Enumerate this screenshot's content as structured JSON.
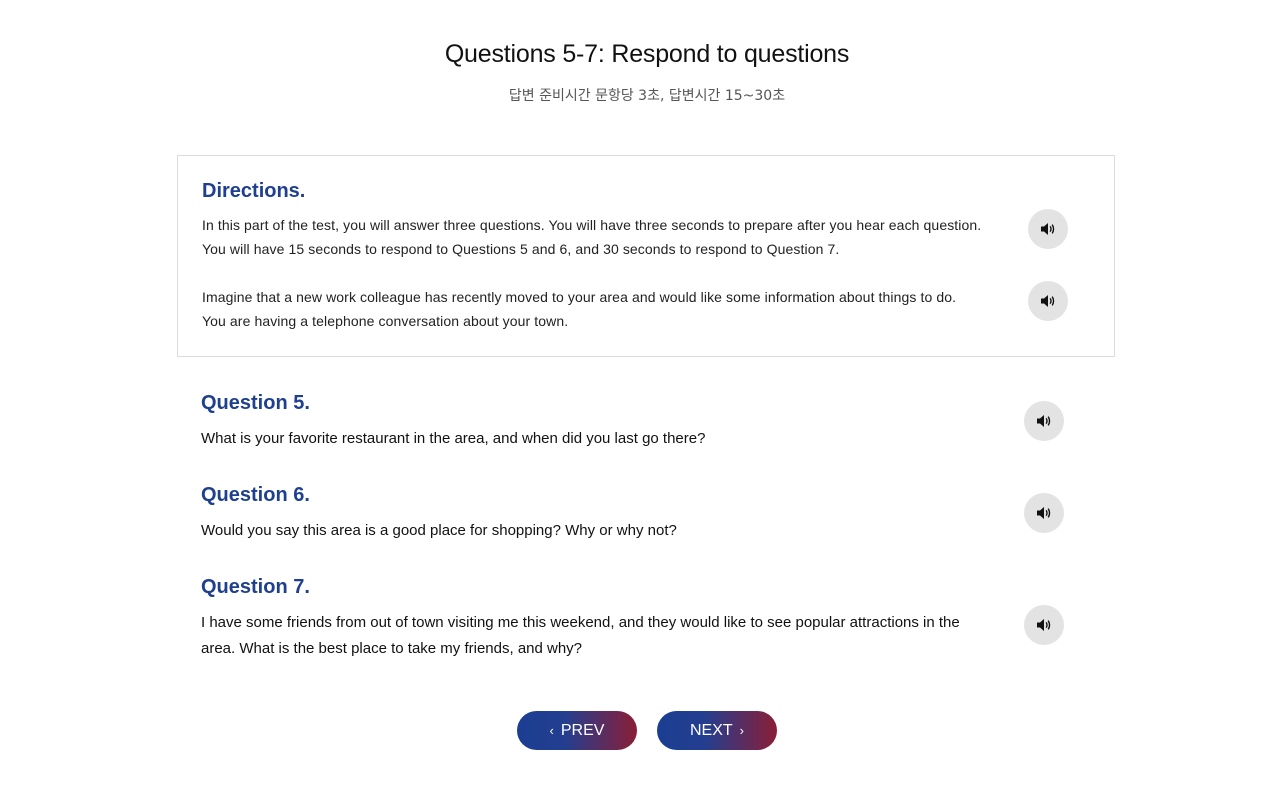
{
  "header": {
    "title": "Questions 5-7: Respond to questions",
    "subtitle": "답변 준비시간 문항당 3초, 답변시간 15~30초"
  },
  "directions": {
    "title": "Directions.",
    "paragraph_1": "In this part of the test, you will answer three questions. You will have three seconds to prepare after you hear each question. You will have 15 seconds to respond to Questions 5 and 6, and 30 seconds to respond to Question 7.",
    "paragraph_2": "Imagine that a new work colleague has recently moved to your area and would like some information about things to do. You are having a telephone conversation about your town."
  },
  "questions": [
    {
      "title": "Question 5.",
      "text": "What is your favorite restaurant in the area, and when did you last go there?"
    },
    {
      "title": "Question 6.",
      "text": "Would you say this area is a good place for shopping? Why or why not?"
    },
    {
      "title": "Question 7.",
      "text": "I have some friends from out of town visiting me this weekend, and they would like to see popular attractions in the area. What is the best place to take my friends, and why?"
    }
  ],
  "navigation": {
    "prev_label": "PREV",
    "next_label": "NEXT",
    "prev_icon": "chevron-left-icon",
    "next_icon": "chevron-right-icon"
  },
  "icons": {
    "audio": "speaker-icon"
  },
  "colors": {
    "heading_blue": "#1f3f8f",
    "button_gradient_start": "#1b3e92",
    "button_gradient_end": "#8a1e36",
    "audio_button_bg": "#e3e3e3"
  }
}
